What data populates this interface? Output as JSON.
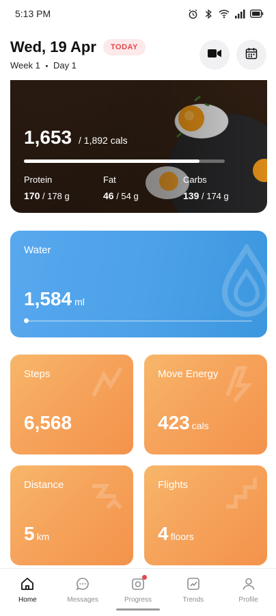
{
  "status_bar": {
    "time": "5:13 PM",
    "icons": [
      "alarm-icon",
      "bluetooth-icon",
      "wifi-icon",
      "signal-icon",
      "battery-icon"
    ]
  },
  "header": {
    "date": "Wed, 19 Apr",
    "today_badge": "TODAY",
    "week_label": "Week 1",
    "separator": "•",
    "day_label": "Day 1",
    "actions": [
      "video-camera-icon",
      "calendar-icon"
    ]
  },
  "calories": {
    "consumed": "1,653",
    "total": "/ 1,892 cals",
    "progress": 0.874,
    "macros": [
      {
        "label": "Protein",
        "value": "170",
        "goal": "/ 178 g"
      },
      {
        "label": "Fat",
        "value": "46",
        "goal": "/ 54 g"
      },
      {
        "label": "Carbs",
        "value": "139",
        "goal": "/ 174 g"
      }
    ]
  },
  "water": {
    "title": "Water",
    "value": "1,584",
    "unit": "ml",
    "progress": 0.0
  },
  "tiles": [
    {
      "title": "Steps",
      "value": "6,568",
      "unit": ""
    },
    {
      "title": "Move Energy",
      "value": "423",
      "unit": "cals"
    },
    {
      "title": "Distance",
      "value": "5",
      "unit": "km"
    },
    {
      "title": "Flights",
      "value": "4",
      "unit": "floors"
    }
  ],
  "nav": [
    {
      "label": "Home",
      "icon": "home-icon",
      "active": true
    },
    {
      "label": "Messages",
      "icon": "messages-icon",
      "active": false
    },
    {
      "label": "Progress",
      "icon": "progress-icon",
      "active": false,
      "badge": true
    },
    {
      "label": "Trends",
      "icon": "trends-icon",
      "active": false
    },
    {
      "label": "Profile",
      "icon": "profile-icon",
      "active": false
    }
  ],
  "colors": {
    "accent_red": "#e2464d",
    "water_blue": "#4aa0e6",
    "tile_orange": "#f6a35b"
  }
}
